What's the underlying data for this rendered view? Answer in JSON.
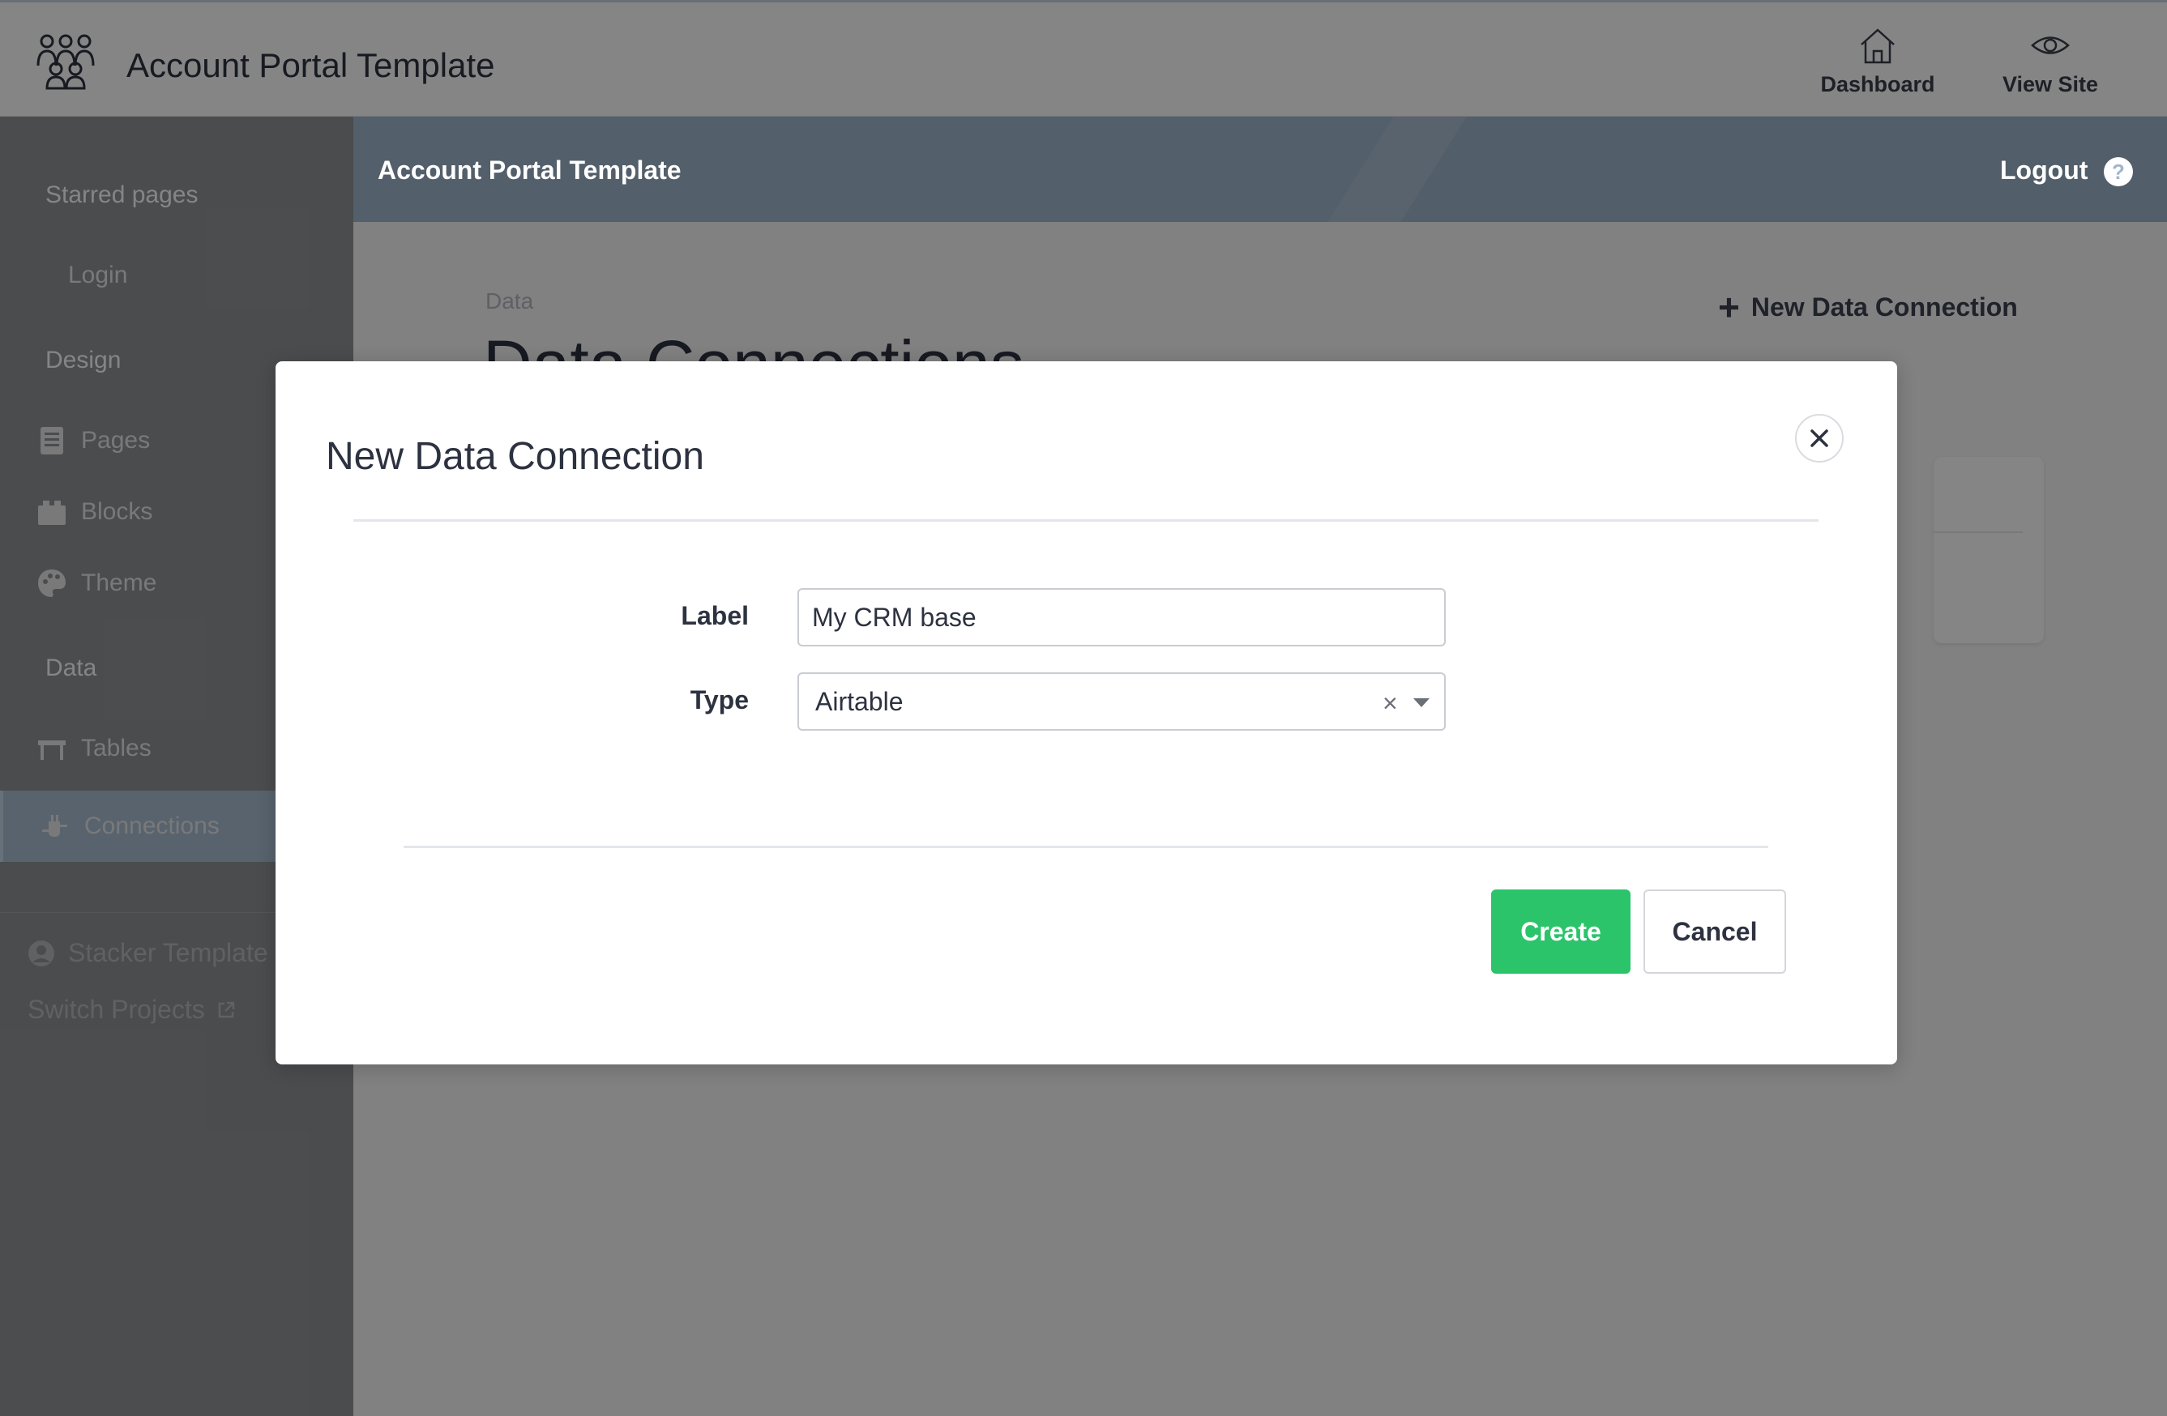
{
  "app": {
    "title": "Account Portal Template",
    "nav": {
      "dashboard": "Dashboard",
      "view_site": "View Site"
    }
  },
  "sidebar": {
    "starred_heading": "Starred pages",
    "starred_items": [
      {
        "label": "Login"
      }
    ],
    "design_heading": "Design",
    "design_items": [
      {
        "label": "Pages",
        "icon": "pages-icon"
      },
      {
        "label": "Blocks",
        "icon": "blocks-icon"
      },
      {
        "label": "Theme",
        "icon": "palette-icon"
      }
    ],
    "data_heading": "Data",
    "data_items": [
      {
        "label": "Tables",
        "icon": "table-icon"
      },
      {
        "label": "Connections",
        "icon": "plug-icon",
        "active": true
      }
    ],
    "project_name": "Stacker Template",
    "switch_projects": "Switch Projects"
  },
  "subheader": {
    "title": "Account Portal Template",
    "logout": "Logout",
    "help": "?"
  },
  "page": {
    "breadcrumb": "Data",
    "title": "Data Connections",
    "new_connection": "New Data Connection"
  },
  "modal": {
    "title": "New Data Connection",
    "label_field": {
      "label": "Label",
      "value": "My CRM base"
    },
    "type_field": {
      "label": "Type",
      "value": "Airtable",
      "clear": "×"
    },
    "create_button": "Create",
    "cancel_button": "Cancel"
  },
  "colors": {
    "accent_green": "#2bc46b",
    "header_blue": "#9fb6cc",
    "sidebar_gray": "#8f9396"
  }
}
